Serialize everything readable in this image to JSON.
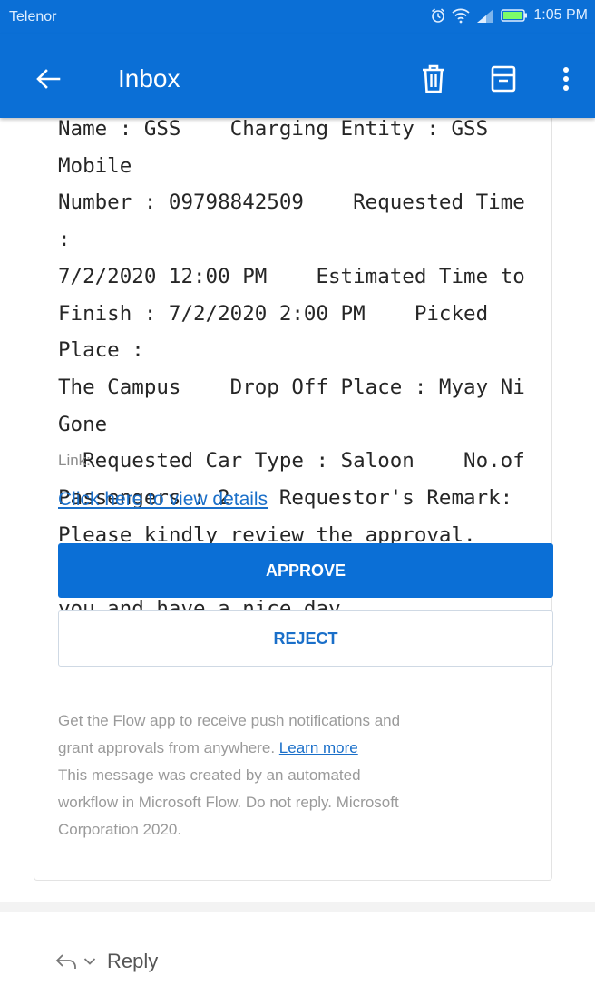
{
  "status_bar": {
    "carrier": "Telenor",
    "time": "1:05 PM"
  },
  "app_bar": {
    "title": "Inbox"
  },
  "message": {
    "body_lines": [
      "Name : GSS    Charging Entity : GSS    Mobile",
      "Number : 09798842509    Requested Time :",
      "7/2/2020 12:00 PM    Estimated Time to",
      "Finish : 7/2/2020 2:00 PM    Picked Place :",
      "The Campus    Drop Off Place : Myay Ni Gone",
      "  Requested Car Type : Saloon    No.of",
      "Passengers : 2    Requestor's Remark:",
      "Please kindly review the approval.    Thank",
      "you and have a nice day."
    ],
    "link_label": "Link:",
    "link_text": "Click here to view details",
    "approve_label": "APPROVE",
    "reject_label": "REJECT",
    "footer": {
      "line1": "Get the Flow app to receive push notifications and",
      "line2_prefix": "grant approvals from anywhere. ",
      "learn_more": "Learn more",
      "line3": "This message was created by an automated",
      "line4": "workflow in Microsoft Flow. Do not reply. Microsoft",
      "line5": "Corporation 2020."
    }
  },
  "reply": {
    "label": "Reply"
  },
  "colors": {
    "primary": "#0b6fd6",
    "link": "#1a6fc9",
    "muted_text": "#9a9a9a"
  },
  "icons": [
    "back-arrow-icon",
    "trash-icon",
    "archive-icon",
    "more-vert-icon",
    "alarm-icon",
    "wifi-icon",
    "signal-icon",
    "battery-icon",
    "reply-icon",
    "chevron-down-icon"
  ]
}
